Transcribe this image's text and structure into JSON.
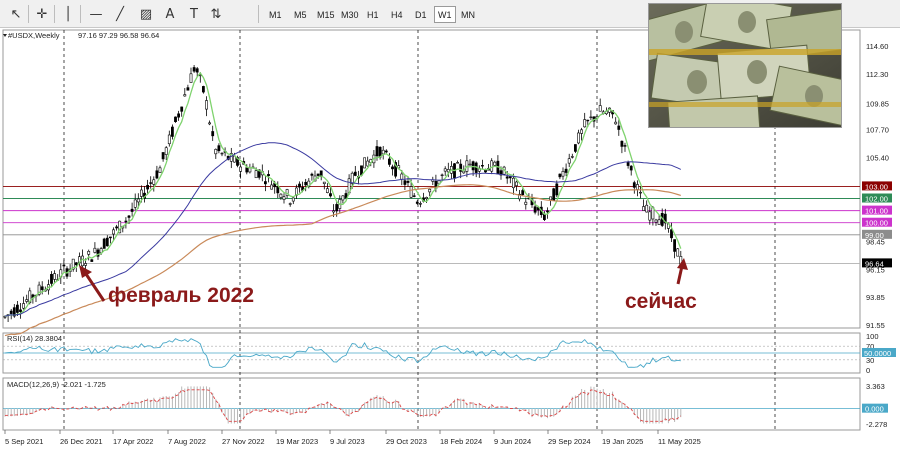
{
  "toolbar": {
    "tools": [
      {
        "name": "cursor-icon",
        "glyph": "↖"
      },
      {
        "name": "crosshair-icon",
        "glyph": "✛"
      },
      {
        "name": "vertical-line-icon",
        "glyph": "│"
      },
      {
        "name": "horizontal-line-icon",
        "glyph": "—"
      },
      {
        "name": "trendline-icon",
        "glyph": "╱"
      },
      {
        "name": "channel-icon",
        "glyph": "▨"
      },
      {
        "name": "text-icon",
        "glyph": "A"
      },
      {
        "name": "label-icon",
        "glyph": "T"
      },
      {
        "name": "arrows-icon",
        "glyph": "⇅"
      }
    ],
    "timeframes": [
      "M1",
      "M5",
      "M15",
      "M30",
      "H1",
      "H4",
      "D1",
      "W1",
      "MN"
    ],
    "active_timeframe": "W1"
  },
  "main": {
    "symbol_header": "#USDX,Weekly",
    "ohlc": "97.16 97.29 96.58 96.64",
    "price_axis": [
      "114.60",
      "112.30",
      "109.85",
      "107.70",
      "105.40",
      "103.00",
      "102.00",
      "101.00",
      "100.00",
      "99.00",
      "98.45",
      "96.64",
      "96.15",
      "93.85",
      "91.55"
    ],
    "current_price": "96.64",
    "level_labels": [
      {
        "price": "103.00",
        "color": "#8b0000"
      },
      {
        "price": "102.00",
        "color": "#2e8b57"
      },
      {
        "price": "101.00",
        "color": "#cc33cc"
      },
      {
        "price": "100.00",
        "color": "#cc33cc"
      },
      {
        "price": "99.00",
        "color": "#8c8c8c"
      }
    ],
    "annotations": {
      "feb2022": "февраль 2022",
      "now": "сейчас"
    }
  },
  "rsi": {
    "header": "RSI(14) 28.3804",
    "axis": [
      "100",
      "70",
      "30",
      "0"
    ],
    "value_label": "50.0000"
  },
  "macd": {
    "header": "MACD(12,26,9) -2.021 -1.725",
    "axis": [
      "3.363",
      "0.000",
      "-2.278"
    ],
    "value_label": "0.000"
  },
  "time_axis": [
    "5 Sep 2021",
    "26 Dec 2021",
    "17 Apr 2022",
    "7 Aug 2022",
    "27 Nov 2022",
    "19 Mar 2023",
    "9 Jul 2023",
    "29 Oct 2023",
    "18 Feb 2024",
    "9 Jun 2024",
    "29 Sep 2024",
    "19 Jan 2025",
    "11 May 2025"
  ],
  "colors": {
    "background": "#ffffff",
    "candle": "#000000",
    "ma_fast": "#7fd36e",
    "ma_mid": "#3a3aa0",
    "ma_slow": "#c98a5a",
    "rsi": "#4aa8c8",
    "macd_signal": "#d44",
    "axis_label_bg": "#000000"
  },
  "chart_data": {
    "type": "line",
    "title": "#USDX,Weekly",
    "ylim": [
      91.0,
      115.5
    ],
    "x": [
      "2021-09-05",
      "2021-12-26",
      "2022-04-17",
      "2022-08-07",
      "2022-11-27",
      "2023-03-19",
      "2023-07-09",
      "2023-10-29",
      "2024-02-18",
      "2024-06-09",
      "2024-09-29",
      "2025-01-19",
      "2025-05-11",
      "2025-06-22"
    ],
    "series": [
      {
        "name": "close",
        "values": [
          92.2,
          96.0,
          100.4,
          106.0,
          105.2,
          102.8,
          101.4,
          106.0,
          104.0,
          104.3,
          100.3,
          108.8,
          99.3,
          96.64
        ]
      }
    ],
    "horizontal_levels": [
      103.0,
      102.0,
      101.0,
      100.0,
      99.0
    ]
  }
}
